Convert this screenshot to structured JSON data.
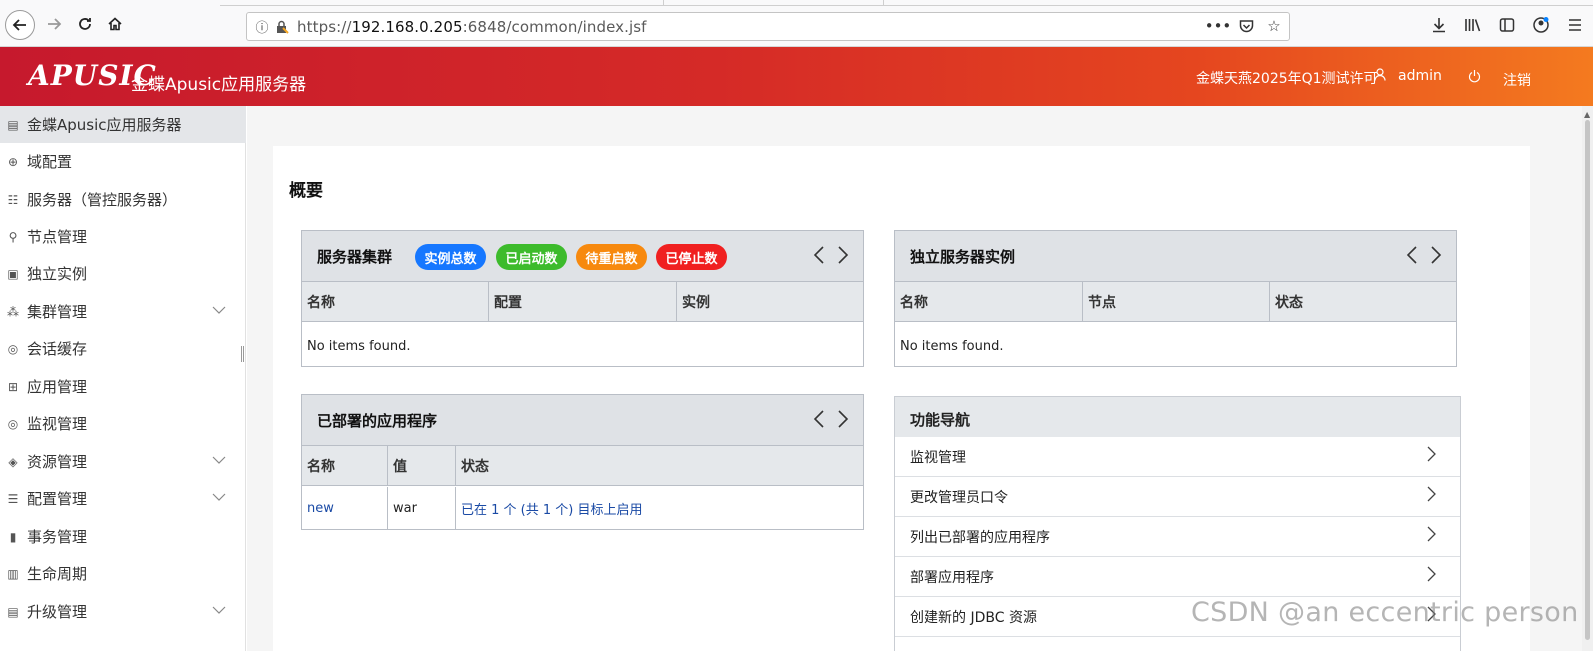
{
  "browser": {
    "url_prefix": "https://",
    "url_host": "192.168.0.205",
    "url_rest": ":6848/common/index.jsf",
    "more_glyph": "•••"
  },
  "header": {
    "logo": "APUSIC",
    "title": "金蝶Apusic应用服务器",
    "license": "金蝶天燕2025年Q1测试许可",
    "username": "admin",
    "logout": "注销",
    "gradient": [
      "#c6192d",
      "#f47a1f"
    ]
  },
  "sidebar": {
    "items": [
      {
        "label": "金蝶Apusic应用服务器",
        "icon": "doc-icon",
        "expandable": false
      },
      {
        "label": "域配置",
        "icon": "globe-icon",
        "expandable": false
      },
      {
        "label": "服务器（管控服务器）",
        "icon": "server-icon",
        "expandable": false
      },
      {
        "label": "节点管理",
        "icon": "node-icon",
        "expandable": false
      },
      {
        "label": "独立实例",
        "icon": "instance-icon",
        "expandable": false
      },
      {
        "label": "集群管理",
        "icon": "cluster-icon",
        "expandable": true
      },
      {
        "label": "会话缓存",
        "icon": "session-icon",
        "expandable": false
      },
      {
        "label": "应用管理",
        "icon": "apps-icon",
        "expandable": false
      },
      {
        "label": "监视管理",
        "icon": "monitor-icon",
        "expandable": false
      },
      {
        "label": "资源管理",
        "icon": "layers-icon",
        "expandable": true
      },
      {
        "label": "配置管理",
        "icon": "sliders-icon",
        "expandable": true
      },
      {
        "label": "事务管理",
        "icon": "phone-icon",
        "expandable": false
      },
      {
        "label": "生命周期",
        "icon": "bars-icon",
        "expandable": false
      },
      {
        "label": "升级管理",
        "icon": "upgrade-icon",
        "expandable": true
      }
    ]
  },
  "main": {
    "title": "概要",
    "cluster_panel": {
      "title": "服务器集群",
      "badges": [
        {
          "label": "实例总数",
          "color": "#1677ff"
        },
        {
          "label": "已启动数",
          "color": "#3dbb2c"
        },
        {
          "label": "待重启数",
          "color": "#f7890e"
        },
        {
          "label": "已停止数",
          "color": "#f02020"
        }
      ],
      "columns": [
        "名称",
        "配置",
        "实例"
      ],
      "empty": "No items found."
    },
    "standalone_panel": {
      "title": "独立服务器实例",
      "columns": [
        "名称",
        "节点",
        "状态"
      ],
      "empty": "No items found."
    },
    "apps_panel": {
      "title": "已部署的应用程序",
      "columns": [
        "名称",
        "值",
        "状态"
      ],
      "rows": [
        {
          "name": "new",
          "value": "war",
          "status": "已在 1 个 (共 1 个) 目标上启用"
        }
      ]
    },
    "nav_panel": {
      "title": "功能导航",
      "items": [
        "监视管理",
        "更改管理员口令",
        "列出已部署的应用程序",
        "部署应用程序",
        "创建新的 JDBC 资源"
      ]
    }
  },
  "watermark": "CSDN @an eccentric person"
}
